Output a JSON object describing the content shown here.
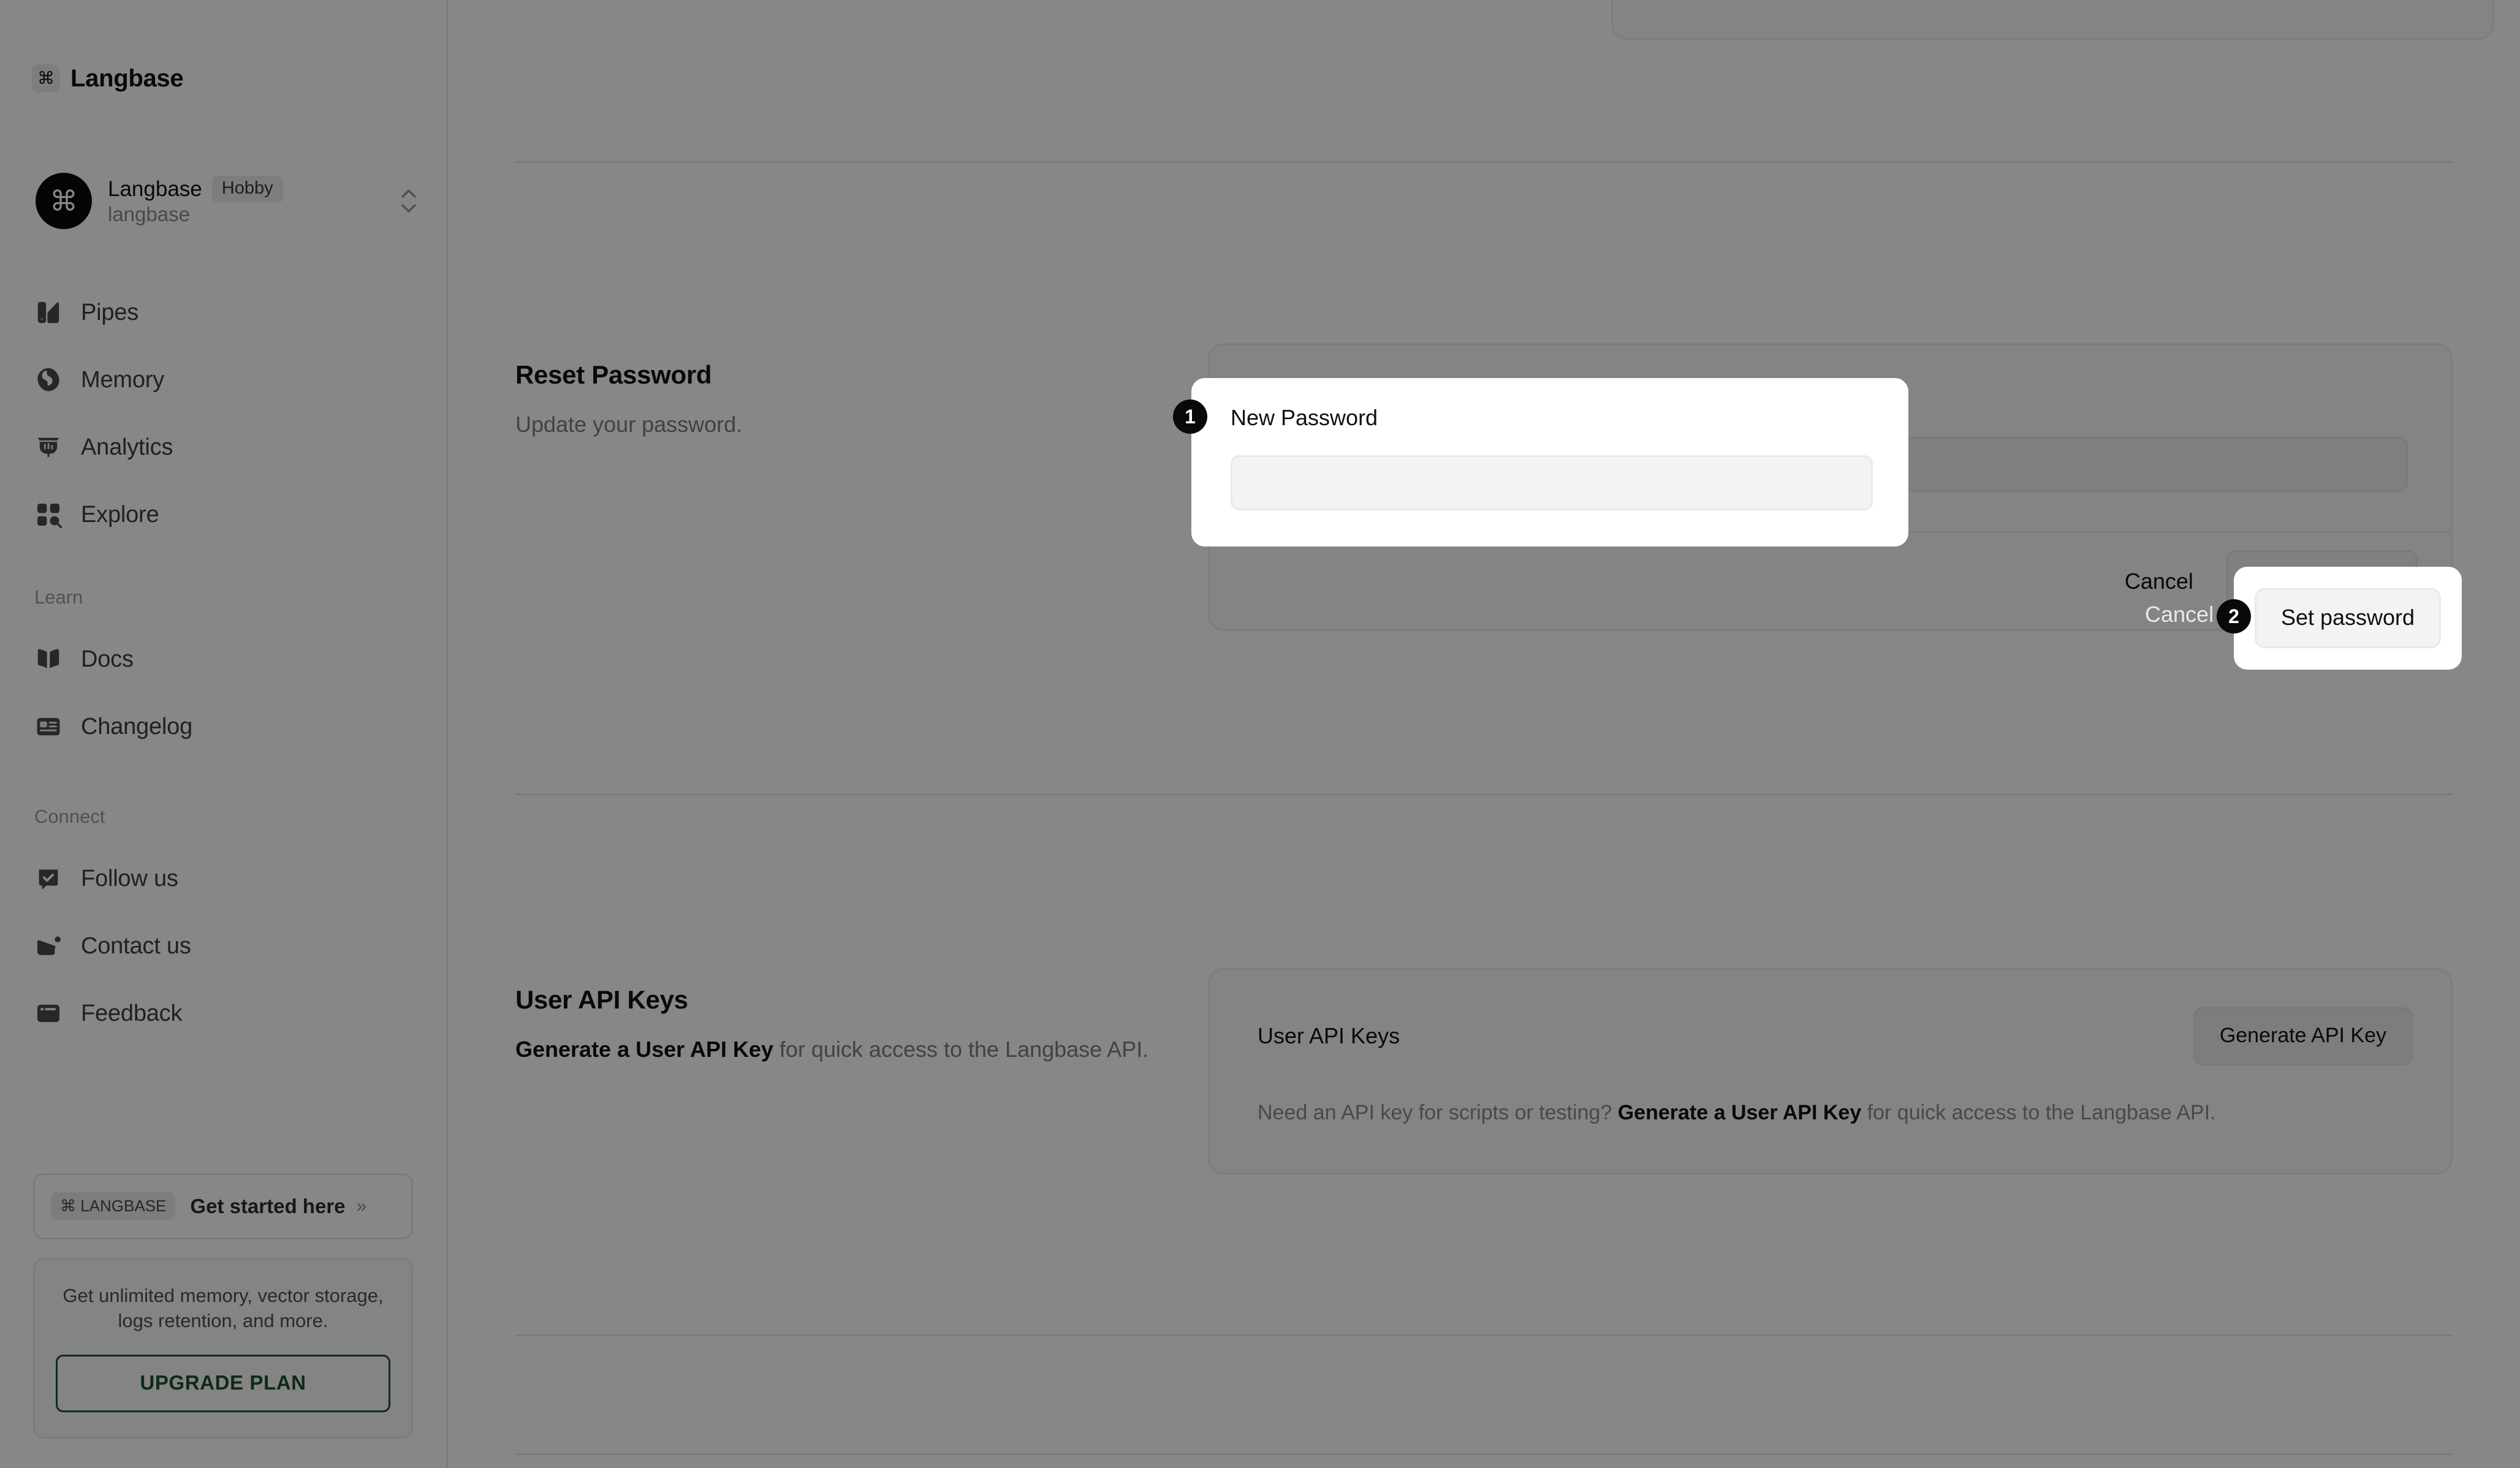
{
  "brand": {
    "mark_icon": "command-icon",
    "name": "Langbase"
  },
  "org": {
    "avatar_icon": "command-icon",
    "name": "Langbase",
    "plan_badge": "Hobby",
    "handle": "langbase",
    "switcher_icon": "chevron-up-down-icon"
  },
  "sidebar": {
    "primary_items": [
      {
        "label": "Pipes",
        "icon": "pipes-icon"
      },
      {
        "label": "Memory",
        "icon": "memory-icon"
      },
      {
        "label": "Analytics",
        "icon": "analytics-icon"
      },
      {
        "label": "Explore",
        "icon": "explore-icon"
      }
    ],
    "learn_title": "Learn",
    "learn_items": [
      {
        "label": "Docs",
        "icon": "book-icon"
      },
      {
        "label": "Changelog",
        "icon": "changelog-icon"
      }
    ],
    "connect_title": "Connect",
    "connect_items": [
      {
        "label": "Follow us",
        "icon": "badge-check-icon"
      },
      {
        "label": "Contact us",
        "icon": "contact-icon"
      },
      {
        "label": "Feedback",
        "icon": "feedback-icon"
      }
    ],
    "get_started": {
      "tag": "⌘ LANGBASE",
      "label": "Get started here",
      "arrow": "»"
    },
    "upgrade": {
      "copy": "Get unlimited memory, vector storage, logs retention, and more.",
      "button": "UPGRADE PLAN",
      "accent_color": "#1c5228"
    }
  },
  "main": {
    "reset_password": {
      "title": "Reset Password",
      "description": "Update your password.",
      "field_label": "New Password",
      "field_value": "",
      "cancel_label": "Cancel",
      "submit_label": "Set password"
    },
    "user_api_keys": {
      "title": "User API Keys",
      "description_strong": "Generate a User API Key",
      "description_rest": " for quick access to the Langbase API.",
      "panel_title": "User API Keys",
      "generate_button": "Generate API Key",
      "note_prefix": "Need an API key for scripts or testing? ",
      "note_strong": "Generate a User API Key",
      "note_suffix": " for quick access to the Langbase API."
    }
  },
  "highlights": {
    "step1": {
      "badge": "1",
      "label": "New Password"
    },
    "step2": {
      "badge": "2",
      "label": "Set password"
    }
  }
}
